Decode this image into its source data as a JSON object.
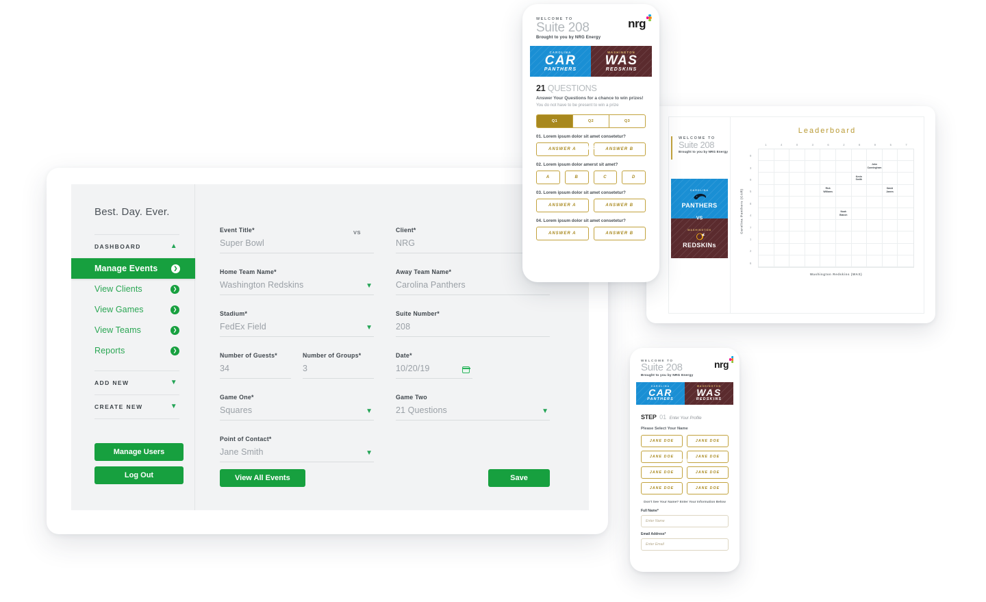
{
  "desktop": {
    "brand": "Best. Day. Ever.",
    "nav_groups": [
      {
        "label": "DASHBOARD",
        "chevron": "chevron-up-icon",
        "expanded": true,
        "items": [
          {
            "label": "Manage Events",
            "active": true,
            "badge": "chevron-right-badge"
          },
          {
            "label": "View Clients",
            "active": false,
            "badge": "chevron-right-badge"
          },
          {
            "label": "View Games",
            "active": false,
            "badge": "chevron-right-badge"
          },
          {
            "label": "View Teams",
            "active": false,
            "badge": "chevron-right-badge"
          },
          {
            "label": "Reports",
            "active": false,
            "badge": "chevron-right-badge"
          }
        ]
      },
      {
        "label": "ADD NEW",
        "chevron": "chevron-down-icon",
        "expanded": false,
        "items": []
      },
      {
        "label": "CREATE NEW",
        "chevron": "chevron-down-icon",
        "expanded": false,
        "items": []
      }
    ],
    "sidebar_buttons": [
      {
        "label": "Manage Users"
      },
      {
        "label": "Log Out"
      }
    ],
    "form": {
      "vs_mark": "VS",
      "fields": {
        "event_title": {
          "label": "Event Title*",
          "value": "Super Bowl"
        },
        "client": {
          "label": "Client*",
          "value": "NRG"
        },
        "home_team": {
          "label": "Home Team Name*",
          "value": "Washington Redskins"
        },
        "away_team": {
          "label": "Away Team Name*",
          "value": "Carolina Panthers"
        },
        "stadium": {
          "label": "Stadium*",
          "value": "FedEx Field"
        },
        "suite_number": {
          "label": "Suite Number*",
          "value": "208"
        },
        "number_of_guests": {
          "label": "Number of Guests*",
          "value": "34"
        },
        "number_of_groups": {
          "label": "Number of Groups*",
          "value": "3"
        },
        "date": {
          "label": "Date*",
          "value": "10/20/19",
          "icon": "calendar-icon"
        },
        "game_one": {
          "label": "Game One*",
          "value": "Squares"
        },
        "game_two": {
          "label": "Game Two",
          "value": "21 Questions"
        },
        "point_of_contact": {
          "label": "Point of Contact*",
          "value": "Jane Smith"
        }
      }
    },
    "footer_buttons": [
      {
        "label": "View All Events"
      },
      {
        "label": "Save"
      }
    ]
  },
  "app_header": {
    "logo": "nrg",
    "welcome_to": "WELCOME TO",
    "suite": "Suite 208",
    "brought_by": "Brought to you by NRG Energy"
  },
  "team_band": {
    "vs": "VS",
    "away": {
      "city": "CAROLINA",
      "abbr": "CAR",
      "name": "PANTHERS",
      "color": "#1a8fd4"
    },
    "home": {
      "city": "WASHINGTON",
      "abbr": "WAS",
      "name": "REDSKINS",
      "color": "#5b2b2e"
    }
  },
  "phone_questions": {
    "title_num": "21",
    "title_word": "QUESTIONS",
    "subtitle": "Answer Your Questions for a chance to win prizes!",
    "note": "You do not have to be present to win a prize",
    "tabs": [
      {
        "label": "Q1",
        "active": true
      },
      {
        "label": "Q2",
        "active": false
      },
      {
        "label": "Q3",
        "active": false
      }
    ],
    "questions": [
      {
        "q": "01. Lorem ipsum dolor sit amet consetetur?",
        "answers": [
          "ANSWER A",
          "ANSWER B"
        ]
      },
      {
        "q": "02. Lorem ipsum dolor amerst sit amet?",
        "answers": [
          "A",
          "B",
          "C",
          "D"
        ]
      },
      {
        "q": "03. Lorem ipsum dolor sit amet consetetur?",
        "answers": [
          "ANSWER A",
          "ANSWER B"
        ]
      },
      {
        "q": "04. Lorem ipsum dolor sit amet consetetur?",
        "answers": [
          "ANSWER A",
          "ANSWER B"
        ]
      }
    ]
  },
  "phone_profile": {
    "step_label": "STEP",
    "step_number": "01",
    "step_title": "Enter Your Profile",
    "select_prompt": "Please Select Your Name",
    "names": [
      "JANE DOE",
      "JANE DOE",
      "JANE DOE",
      "JANE DOE",
      "JANE DOE",
      "JANE DOE",
      "JANE DOE",
      "JANE DOE"
    ],
    "note": "Don't See Your Name? Enter Your Information Below",
    "full_name": {
      "label": "Full Name*",
      "placeholder": "Enter Name"
    },
    "email": {
      "label": "Email Address*",
      "placeholder": "Enter Email"
    }
  },
  "tablet": {
    "leaderboard_title": "Leaderboard",
    "teams": {
      "away": {
        "city": "CAROLINA",
        "name": "PANTHERS"
      },
      "home": {
        "city": "WASHINGTON",
        "name": "REDSKINs"
      },
      "vs": "VS"
    }
  },
  "chart_data": {
    "type": "heatmap",
    "title": "Leaderboard",
    "xlabel": "Washington Redskins (WAS)",
    "ylabel": "Carolina Panthers (CAR)",
    "x_ticks": [
      "1",
      "4",
      "0",
      "3",
      "6",
      "2",
      "8",
      "9",
      "5",
      "7"
    ],
    "y_ticks": [
      "9",
      "3",
      "9",
      "5",
      "8",
      "4",
      "7",
      "1",
      "2",
      "6"
    ],
    "grid": true,
    "legend": "none",
    "cells": [
      {
        "col": 7,
        "row": 1,
        "name": "John Cunningham"
      },
      {
        "col": 6,
        "row": 2,
        "name": "Kevin Smith"
      },
      {
        "col": 4,
        "row": 3,
        "name": "Rick Williams"
      },
      {
        "col": 8,
        "row": 3,
        "name": "David James"
      },
      {
        "col": 5,
        "row": 5,
        "name": "Noah Blanch"
      }
    ]
  },
  "theme": {
    "green": "#17a03f",
    "gold": "#a8881e",
    "panthers_blue": "#1a8fd4",
    "redskins_maroon": "#5b2b2e",
    "page_bg": "#f2f3f4"
  }
}
